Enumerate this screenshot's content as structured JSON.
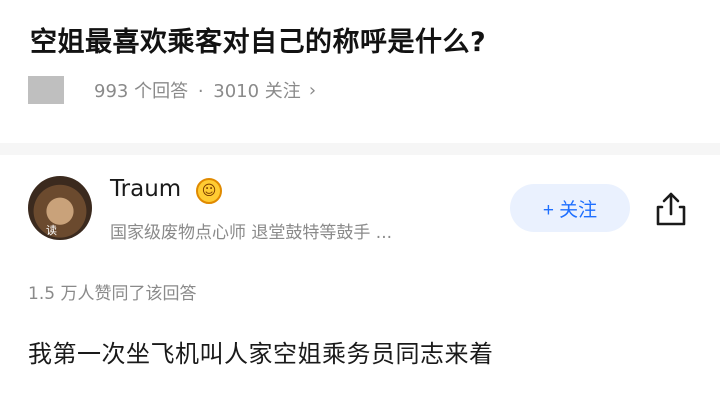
{
  "question": {
    "title": "空姐最喜欢乘客对自己的称呼是什么?",
    "answers": "993 个回答",
    "separator": "·",
    "followers": "3010 关注",
    "chevron": "›"
  },
  "answer": {
    "author": {
      "name": "Traum",
      "badge_icon": "emoji-face-icon",
      "badge_glyph": "☺",
      "bio": "国家级废物点心师 退堂鼓特等鼓手 ...",
      "avatar_text": "读"
    },
    "follow_label": "+ 关注",
    "share_icon": "share-icon",
    "likes": "1.5 万人赞同了该回答",
    "content": "我第一次坐飞机叫人家空姐乘务员同志来着"
  },
  "colors": {
    "accent": "#1e6fff",
    "accent_bg": "#eaf1fe",
    "muted_text": "#8a8a8a"
  }
}
